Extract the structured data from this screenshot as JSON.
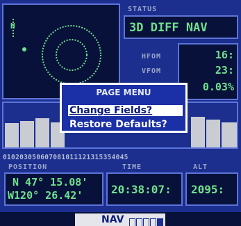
{
  "status": {
    "label": "STATUS",
    "mode": "3D DIFF NAV"
  },
  "precision": {
    "hfom_label": "HFOM",
    "vfom_label": "VFOM",
    "hfom_value": "16:",
    "vfom_value": "23:",
    "epe_value": "0.03%"
  },
  "menu": {
    "title": "PAGE MENU",
    "items": [
      "Change Fields?",
      "Restore Defaults?"
    ]
  },
  "satellites": {
    "labels": [
      "01",
      "02",
      "03",
      "05",
      "06",
      "07",
      "08",
      "10",
      "11",
      "12",
      "13",
      "15",
      "35",
      "40",
      "45"
    ],
    "levels": [
      0.4,
      0.45,
      0.5,
      0.45,
      0.5,
      0.55,
      0.5,
      0.45,
      0.5,
      0.55,
      0.5,
      0.6,
      0.55,
      0.5,
      0.45
    ]
  },
  "fields": {
    "position_label": "POSITION",
    "time_label": "TIME",
    "alt_label": "ALT",
    "lat": "N 47° 15.08'",
    "lon": "W120° 26.42'",
    "time": "20:38:07:",
    "alt": "2095:"
  },
  "bottom": {
    "page": "NAV"
  }
}
